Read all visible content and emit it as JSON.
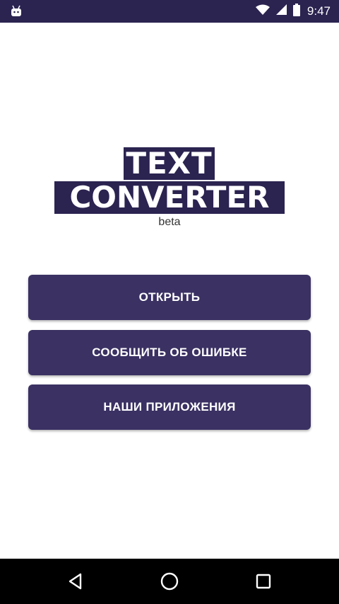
{
  "status_bar": {
    "time": "9:47",
    "left_icon": "android-debug-icon",
    "icons": [
      "wifi-icon",
      "cellular-signal-icon",
      "battery-icon"
    ]
  },
  "logo": {
    "line1": "TEXT",
    "line2": "CONVERTER",
    "subtitle": "beta"
  },
  "buttons": {
    "open": "ОТКРЫТЬ",
    "report": "СООБЩИТЬ ОБ ОШИБКЕ",
    "apps": "НАШИ ПРИЛОЖЕНИЯ"
  },
  "nav_bar": {
    "icons": [
      "back-icon",
      "home-icon",
      "recents-icon"
    ]
  },
  "colors": {
    "primary": "#3b3163",
    "status_bar": "#2b2350",
    "background": "#ffffff",
    "nav_bar": "#000000"
  }
}
